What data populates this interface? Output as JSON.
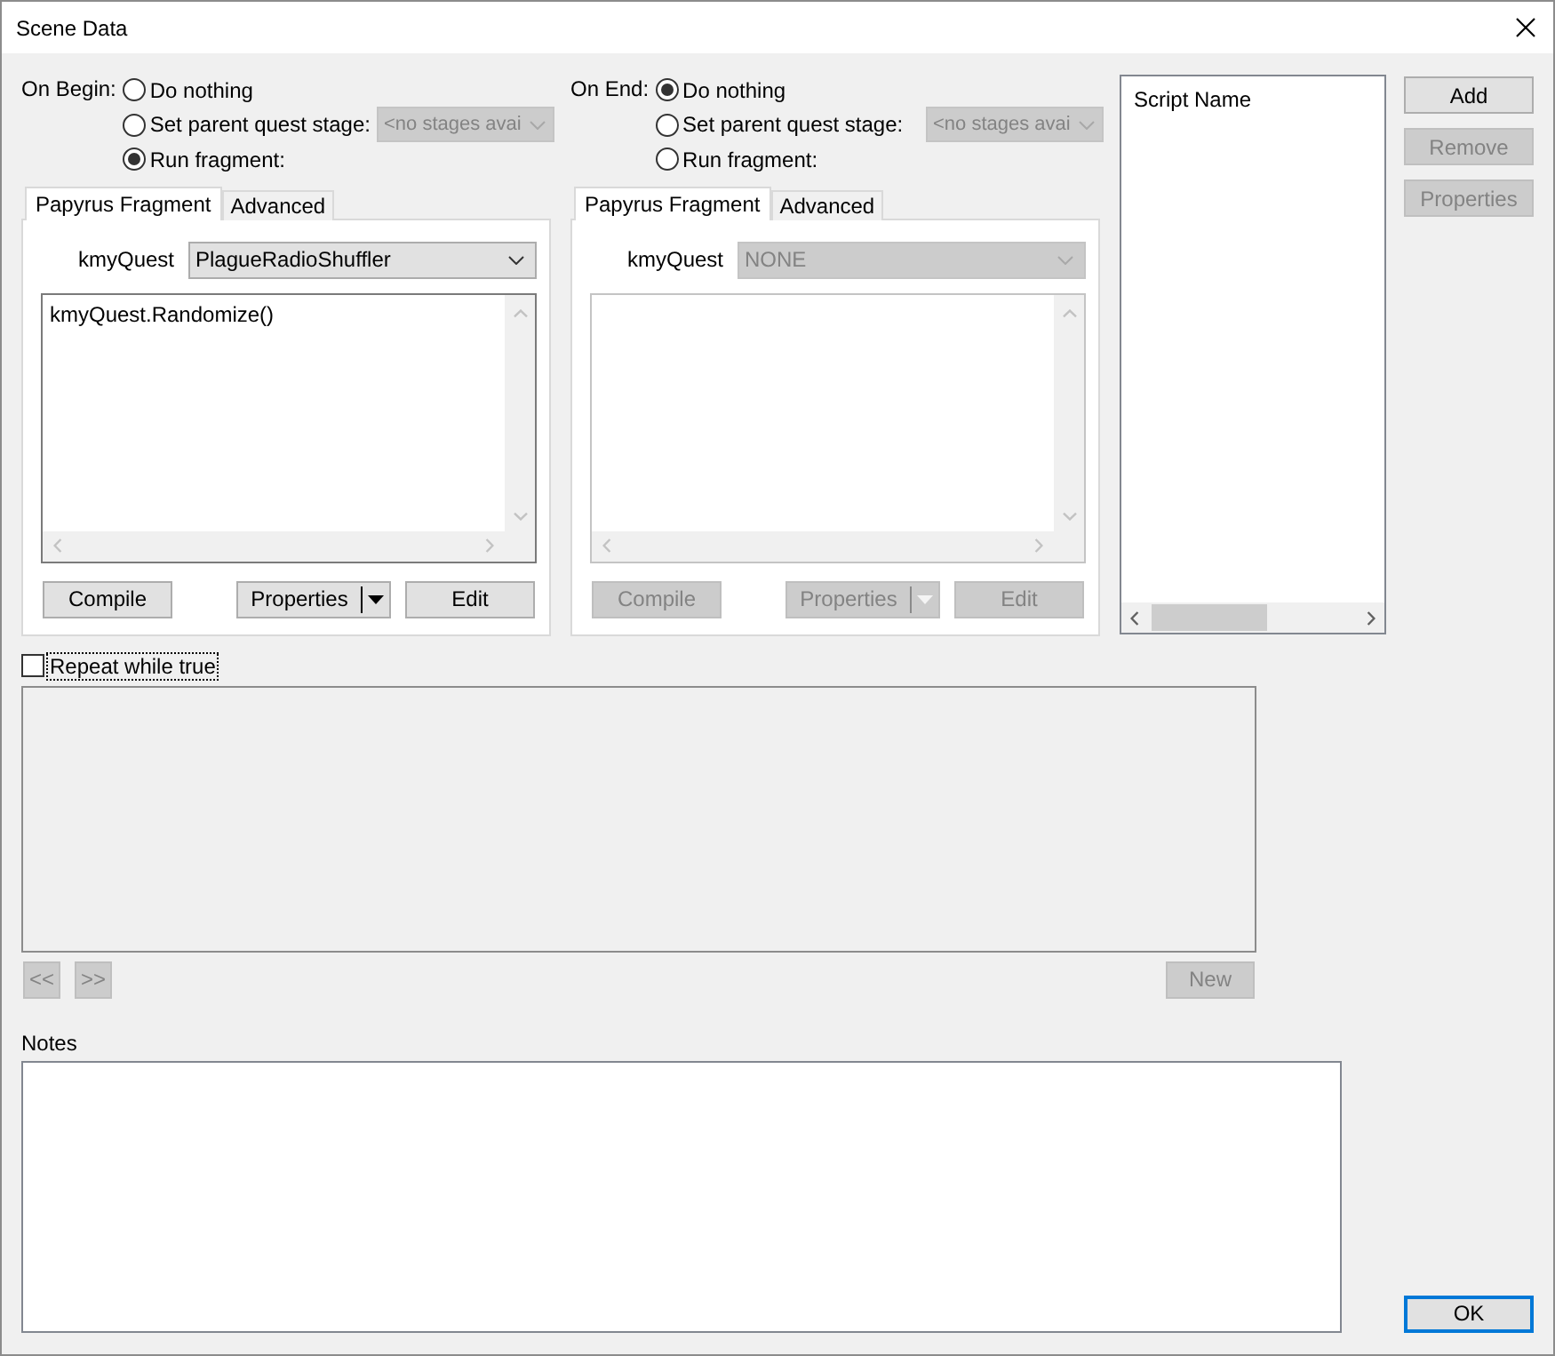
{
  "window": {
    "title": "Scene Data"
  },
  "on_begin": {
    "label": "On Begin:",
    "options": [
      {
        "label": "Do nothing",
        "selected": false
      },
      {
        "label": "Set parent quest stage:",
        "selected": false,
        "dropdown": {
          "value": "<no stages avai",
          "disabled": true
        }
      },
      {
        "label": "Run fragment:",
        "selected": true
      }
    ],
    "tabs": [
      {
        "label": "Papyrus Fragment",
        "selected": true
      },
      {
        "label": "Advanced",
        "selected": false
      }
    ],
    "quest_label": "kmyQuest",
    "quest_dropdown": {
      "value": "PlagueRadioShuffler",
      "disabled": false
    },
    "editor": {
      "text": "kmyQuest.Randomize()",
      "disabled": false
    },
    "buttons": [
      {
        "label": "Compile",
        "kind": "button",
        "disabled": false
      },
      {
        "label": "Properties",
        "kind": "split",
        "disabled": false
      },
      {
        "label": "Edit",
        "kind": "button",
        "disabled": false
      }
    ]
  },
  "on_end": {
    "label": "On End:",
    "options": [
      {
        "label": "Do nothing",
        "selected": true
      },
      {
        "label": "Set parent quest stage:",
        "selected": false,
        "dropdown": {
          "value": "<no stages avai",
          "disabled": true
        }
      },
      {
        "label": "Run fragment:",
        "selected": false
      }
    ],
    "tabs": [
      {
        "label": "Papyrus Fragment",
        "selected": true
      },
      {
        "label": "Advanced",
        "selected": false
      }
    ],
    "quest_label": "kmyQuest",
    "quest_dropdown": {
      "value": "NONE",
      "disabled": true
    },
    "editor": {
      "disabled": true
    },
    "buttons": [
      {
        "label": "Compile",
        "kind": "button",
        "disabled": true
      },
      {
        "label": "Properties",
        "kind": "split",
        "disabled": true
      },
      {
        "label": "Edit",
        "kind": "button",
        "disabled": true
      }
    ]
  },
  "script_list": {
    "column": "Script Name"
  },
  "script_buttons": [
    {
      "label": "Add",
      "disabled": false
    },
    {
      "label": "Remove",
      "disabled": true
    },
    {
      "label": "Properties",
      "disabled": true
    }
  ],
  "repeat": {
    "label": "Repeat while true",
    "checked": false,
    "focused": true
  },
  "navigation": [
    {
      "label": "<<",
      "disabled": true
    },
    {
      "label": ">>",
      "disabled": true
    }
  ],
  "new_button": {
    "label": "New",
    "disabled": true
  },
  "notes": {
    "label": "Notes"
  },
  "ok_button": {
    "label": "OK",
    "default": true
  }
}
